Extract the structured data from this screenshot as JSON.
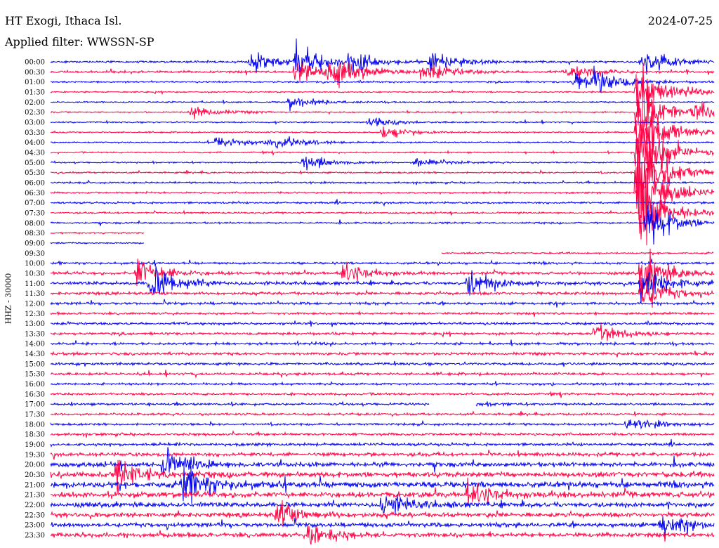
{
  "header": {
    "station": "HT Exogi, Ithaca Isl.",
    "date": "2024-07-25",
    "filter_prefix": "Applied filter:",
    "filter_name": "WWSSN-SP"
  },
  "chart_data": {
    "type": "line",
    "title": "HT Exogi, Ithaca Isl.",
    "date": "2024-07-25",
    "filter": "WWSSN-SP",
    "ylabel": "HHZ - 30000",
    "row_interval_minutes": 30,
    "series_colors": [
      "#0000ee",
      "#ff0044"
    ],
    "categories": [
      "00:00",
      "00:30",
      "01:00",
      "01:30",
      "02:00",
      "02:30",
      "03:00",
      "03:30",
      "04:00",
      "04:30",
      "05:00",
      "05:30",
      "06:00",
      "06:30",
      "07:00",
      "07:30",
      "08:00",
      "08:30",
      "09:00",
      "09:30",
      "10:00",
      "10:30",
      "11:00",
      "11:30",
      "12:00",
      "12:30",
      "13:00",
      "13:30",
      "14:00",
      "14:30",
      "15:00",
      "15:30",
      "16:00",
      "16:30",
      "17:00",
      "17:30",
      "18:00",
      "18:30",
      "19:00",
      "19:30",
      "20:00",
      "20:30",
      "21:00",
      "21:30",
      "22:00",
      "22:30",
      "23:00",
      "23:30"
    ],
    "trace_extent": [
      [
        0,
        1
      ],
      [
        0,
        1
      ],
      [
        0,
        1
      ],
      [
        0,
        1
      ],
      [
        0,
        1
      ],
      [
        0,
        1
      ],
      [
        0,
        1
      ],
      [
        0,
        1
      ],
      [
        0,
        1
      ],
      [
        0,
        1
      ],
      [
        0,
        1
      ],
      [
        0,
        1
      ],
      [
        0,
        1
      ],
      [
        0,
        1
      ],
      [
        0,
        1
      ],
      [
        0,
        1
      ],
      [
        0,
        1
      ],
      [
        0,
        0.14
      ],
      [
        0,
        0.14
      ],
      [
        0.59,
        1
      ],
      [
        0,
        1
      ],
      [
        0,
        1
      ],
      [
        0,
        1
      ],
      [
        0,
        1
      ],
      [
        0,
        1
      ],
      [
        0,
        1
      ],
      [
        0,
        1
      ],
      [
        0,
        1
      ],
      [
        0,
        1
      ],
      [
        0,
        1
      ],
      [
        0,
        1
      ],
      [
        0,
        1
      ],
      [
        0,
        1
      ],
      [
        0,
        1
      ],
      [
        0,
        1
      ],
      [
        0,
        1
      ],
      [
        0,
        1
      ],
      [
        0,
        1
      ],
      [
        0,
        1
      ],
      [
        0,
        1
      ],
      [
        0,
        1
      ],
      [
        0,
        1
      ],
      [
        0,
        1
      ],
      [
        0,
        1
      ],
      [
        0,
        1
      ],
      [
        0,
        1
      ],
      [
        0,
        1
      ],
      [
        0,
        1
      ]
    ],
    "trace_gaps": [
      {
        "row": 34,
        "from": 0.57,
        "to": 0.64
      }
    ],
    "row_noise_level": [
      0.7,
      0.8,
      0.6,
      0.5,
      0.5,
      0.5,
      0.5,
      0.5,
      0.5,
      0.5,
      0.5,
      0.6,
      0.6,
      0.6,
      0.7,
      0.6,
      0.6,
      0.6,
      0.6,
      0.6,
      0.8,
      1.0,
      1.1,
      1.0,
      0.9,
      0.8,
      0.9,
      0.9,
      0.9,
      1.0,
      0.9,
      0.9,
      0.8,
      0.8,
      0.8,
      0.8,
      0.8,
      0.9,
      1.0,
      1.3,
      1.6,
      1.9,
      2.1,
      2.0,
      1.7,
      1.6,
      1.5,
      1.6
    ],
    "events": [
      {
        "row": 0,
        "at": 0.3,
        "amp": 18
      },
      {
        "row": 0,
        "at": 0.37,
        "amp": 26
      },
      {
        "row": 0,
        "at": 0.45,
        "amp": 24
      },
      {
        "row": 0,
        "at": 0.57,
        "amp": 20
      },
      {
        "row": 0,
        "at": 0.89,
        "amp": 28
      },
      {
        "row": 1,
        "at": 0.37,
        "amp": 22
      },
      {
        "row": 1,
        "at": 0.42,
        "amp": 30
      },
      {
        "row": 1,
        "at": 0.56,
        "amp": 18
      },
      {
        "row": 1,
        "at": 0.78,
        "amp": 14
      },
      {
        "row": 2,
        "at": 0.79,
        "amp": 20
      },
      {
        "row": 2,
        "at": 0.82,
        "amp": 18
      },
      {
        "row": 4,
        "at": 0.36,
        "amp": 10
      },
      {
        "row": 5,
        "at": 0.21,
        "amp": 12
      },
      {
        "row": 5,
        "at": 0.97,
        "amp": 14
      },
      {
        "row": 6,
        "at": 0.48,
        "amp": 8
      },
      {
        "row": 7,
        "at": 0.5,
        "amp": 12
      },
      {
        "row": 8,
        "at": 0.33,
        "amp": 14
      },
      {
        "row": 8,
        "at": 0.25,
        "amp": 10
      },
      {
        "row": 10,
        "at": 0.38,
        "amp": 14
      },
      {
        "row": 10,
        "at": 0.55,
        "amp": 9
      },
      {
        "row": 3,
        "at": 0.885,
        "amp": 48
      },
      {
        "row": 5,
        "at": 0.885,
        "amp": 60
      },
      {
        "row": 7,
        "at": 0.885,
        "amp": 70
      },
      {
        "row": 9,
        "at": 0.885,
        "amp": 80
      },
      {
        "row": 11,
        "at": 0.885,
        "amp": 85
      },
      {
        "row": 13,
        "at": 0.885,
        "amp": 75
      },
      {
        "row": 15,
        "at": 0.89,
        "amp": 60
      },
      {
        "row": 16,
        "at": 0.9,
        "amp": 40
      },
      {
        "row": 21,
        "at": 0.89,
        "amp": 36
      },
      {
        "row": 22,
        "at": 0.89,
        "amp": 30
      },
      {
        "row": 23,
        "at": 0.89,
        "amp": 28
      },
      {
        "row": 27,
        "at": 0.82,
        "amp": 20
      },
      {
        "row": 21,
        "at": 0.13,
        "amp": 28
      },
      {
        "row": 22,
        "at": 0.15,
        "amp": 30
      },
      {
        "row": 21,
        "at": 0.44,
        "amp": 20
      },
      {
        "row": 22,
        "at": 0.63,
        "amp": 22
      },
      {
        "row": 34,
        "at": 0.6,
        "amp": 8
      },
      {
        "row": 36,
        "at": 0.87,
        "amp": 12
      },
      {
        "row": 40,
        "at": 0.17,
        "amp": 26
      },
      {
        "row": 41,
        "at": 0.1,
        "amp": 22
      },
      {
        "row": 42,
        "at": 0.2,
        "amp": 30
      },
      {
        "row": 43,
        "at": 0.63,
        "amp": 22
      },
      {
        "row": 44,
        "at": 0.5,
        "amp": 18
      },
      {
        "row": 45,
        "at": 0.34,
        "amp": 20
      },
      {
        "row": 46,
        "at": 0.92,
        "amp": 18
      },
      {
        "row": 47,
        "at": 0.39,
        "amp": 22
      }
    ]
  }
}
